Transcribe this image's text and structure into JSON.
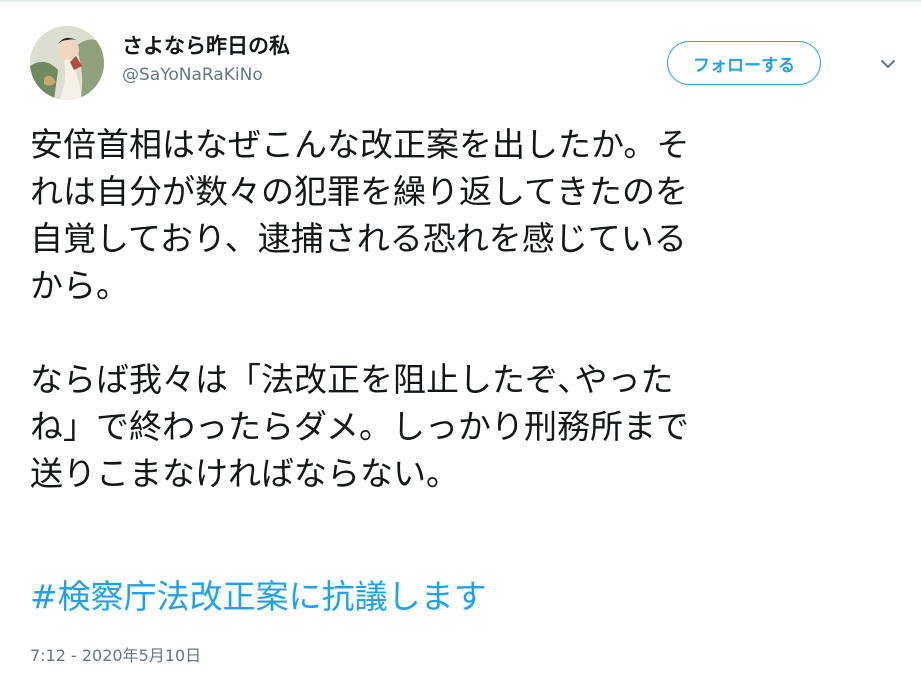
{
  "user": {
    "display_name": "さよなら昨日の私",
    "handle": "@SaYoNaRaKiNo",
    "avatar_icon": "user-avatar"
  },
  "follow_button": {
    "label": "フォローする",
    "color": "#1da1f2"
  },
  "menu": {
    "icon": "chevron-down-icon"
  },
  "tweet": {
    "paragraph_1": "安倍首相はなぜこんな改正案を出したか。そ\nれは自分が数々の犯罪を繰り返してきたのを\n自覚しており、逮捕される恐れを感じている\nから。",
    "paragraph_2": "ならば我々は「法改正を阻止したぞ､やった\nね」で終わったらダメ。しっかり刑務所まで\n送りこまなければならない。",
    "hashtag": "#検察庁法改正案に抗議します",
    "timestamp": "7:12 - 2020年5月10日"
  },
  "colors": {
    "text": "#14171a",
    "secondary": "#657786",
    "accent": "#1da1f2"
  }
}
